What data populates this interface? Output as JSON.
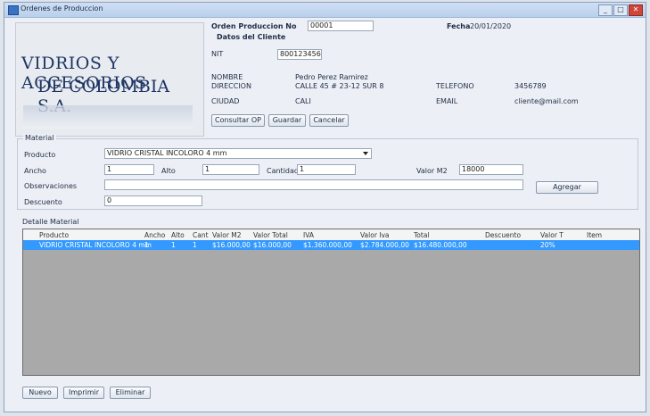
{
  "window": {
    "title": "Ordenes de Produccion"
  },
  "logo": {
    "line1": "VIDRIOS Y ACCESORIOS",
    "line2": "DE COLOMBIA S.A."
  },
  "header": {
    "order_label": "Orden Produccion No",
    "order_value": "00001",
    "date_label": "Fecha",
    "date_value": "20/01/2020",
    "client_section": "Datos del Cliente",
    "nit_label": "NIT",
    "nit_value": "800123456",
    "name_label": "NOMBRE",
    "name_value": "Pedro Perez Ramirez",
    "address_label": "DIRECCION",
    "address_value": "CALLE 45 # 23-12 SUR 8",
    "phone_label": "TELEFONO",
    "phone_value": "3456789",
    "city_label": "CIUDAD",
    "city_value": "CALI",
    "email_label": "EMAIL",
    "email_value": "cliente@mail.com"
  },
  "header_buttons": {
    "consultar": "Consultar OP",
    "guardar": "Guardar",
    "cancelar": "Cancelar"
  },
  "material": {
    "section": "Material",
    "product_label": "Producto",
    "product_value": "VIDRIO CRISTAL INCOLORO 4 mm",
    "ancho_label": "Ancho",
    "ancho_value": "1",
    "alto_label": "Alto",
    "alto_value": "1",
    "cantidad_label": "Cantidad",
    "cantidad_value": "1",
    "valor_label": "Valor M2",
    "valor_value": "18000",
    "obs_label": "Observaciones",
    "obs_value": "",
    "descuento_label": "Descuento",
    "descuento_value": "0",
    "agregar_button": "Agregar"
  },
  "detalle": {
    "section": "Detalle Material",
    "columns": [
      "Producto",
      "Ancho",
      "Alto",
      "Cant",
      "Valor M2",
      "Valor Total",
      "IVA",
      "Valor Iva",
      "Total",
      "Descuento",
      "Valor T",
      "Item"
    ],
    "rows": [
      [
        "VIDRIO CRISTAL INCOLORO 4 mm",
        "1",
        "1",
        "1",
        "$16.000,00",
        "$16.000,00",
        "$1.360.000,00",
        "$2.784.000,00",
        "$16.480.000,00",
        "",
        "20%",
        ""
      ]
    ]
  },
  "footer_buttons": {
    "nuevo": "Nuevo",
    "imprimir": "Imprimir",
    "eliminar": "Eliminar"
  }
}
